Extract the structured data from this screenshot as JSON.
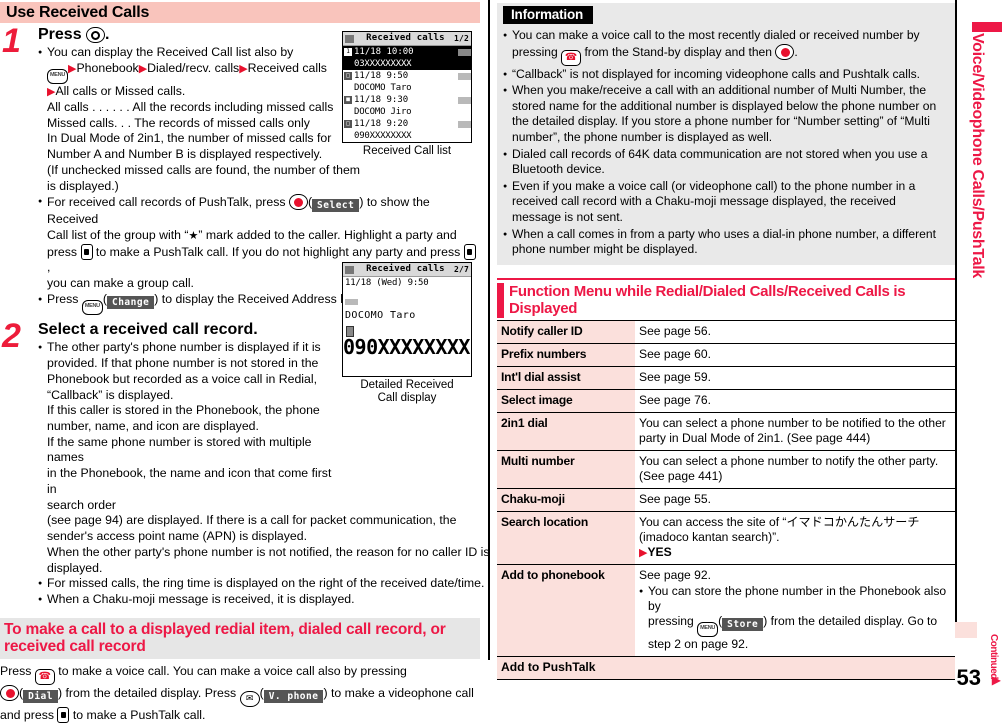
{
  "sidebar": {
    "chapter_title": "Voice/Videophone Calls/PushTalk",
    "continued_label": "Continued",
    "page_number": "53",
    "accent_color": "#ed1846"
  },
  "left": {
    "title": "Use Received Calls",
    "step1": {
      "number": "1",
      "title_pre": "Press",
      "title_post": ".",
      "bullets": [
        {
          "lines": [
            "You can display the Received Call list also by",
            "KEY_MENU ▶Phonebook▶Dialed/recv. calls▶Received calls",
            "▶All calls or Missed calls.",
            "All calls . . . . . .  All the records including missed calls",
            "Missed calls. . .  The records of missed calls only",
            "In Dual Mode of 2in1, the number of missed calls for",
            "Number A and Number B is displayed respectively.",
            "(If unchecked missed calls are found, the number of them is displayed.)"
          ]
        },
        {
          "lines": [
            "For received call records of PushTalk, press KEY_O(Select) to show the Received",
            "Call list of the group with “★” mark added to the caller. Highlight a party and",
            "press KEY_PUSH to make a PushTalk call. If you do not highlight any party and press KEY_PUSH,",
            "you can make a group call."
          ]
        },
        {
          "lines": [
            "Press KEY_MENU(Change) to display the Received Address list."
          ]
        }
      ],
      "softkey_select": "Select",
      "softkey_change": "Change"
    },
    "step2": {
      "number": "2",
      "title": "Select a received call record.",
      "lines": [
        "The other party's phone number is displayed if it is",
        "provided. If that phone number is not stored in the",
        "Phonebook but recorded as a voice call in Redial,",
        "“Callback” is displayed.",
        "If this caller is stored in the Phonebook, the phone",
        "number, name, and icon are displayed.",
        "If the same phone number is stored with multiple names",
        "in the Phonebook, the name and icon that come first in",
        "search order",
        "(see page 94) are displayed. If there is a call for packet communication, the",
        "sender's access point name (APN) is displayed.",
        "When the other party's phone number is not notified, the reason for no caller ID is",
        "displayed."
      ],
      "bullet2": "For missed calls, the ring time is displayed on the right of the received date/time.",
      "bullet3": "When a Chaku-moji message is received, it is displayed."
    },
    "section": {
      "heading_line1": "To make a call to a displayed redial item, dialed call record, or",
      "heading_line2": "received call record",
      "body_l1a": "Press",
      "body_l1b": "to make a voice call. You can make a voice call also by pressing",
      "body_l2a": "from the detailed display. Press",
      "body_l2b": "to make a videophone call",
      "body_l3": "and press",
      "body_l3b": "to make a PushTalk call.",
      "softkey_dial": "Dial",
      "softkey_vphone": "V. phone"
    },
    "screenshot1": {
      "caption": "Received Call list",
      "header_title": "Received calls",
      "header_page": "1/2",
      "rows": [
        {
          "icon": "1",
          "date": "11/18 10:00",
          "tag": "icon-tag",
          "number": "03XXXXXXXXX",
          "selected": true
        },
        {
          "icon": "□",
          "date": "11/18  9:50",
          "tag": "icon-tag",
          "number": "DOCOMO Taro",
          "selected": false
        },
        {
          "icon": "■",
          "date": "11/18  9:30",
          "tag": "icon-tag",
          "number": "DOCOMO Jiro",
          "selected": false
        },
        {
          "icon": "□",
          "date": "11/18  9:20",
          "tag": "icon-tag",
          "number": "090XXXXXXXX",
          "selected": false
        }
      ]
    },
    "screenshot2": {
      "caption_line1": "Detailed Received",
      "caption_line2": "Call display",
      "header_title": "Received calls",
      "header_page": "2/7",
      "datetime": "11/18 (Wed)  9:50",
      "name": "DOCOMO Taro",
      "number": "090XXXXXXXX"
    }
  },
  "right": {
    "info": {
      "label": "Information",
      "bullets": [
        "You can make a voice call to the most recently dialed or received number by pressing KEY_CALL from the Stand-by display and then KEY_O_RED.",
        "“Callback” is not displayed for incoming videophone calls and Pushtalk calls.",
        "When you make/receive a call with an additional number of Multi Number, the stored name for the additional number is displayed below the phone number on the detailed display. If you store a phone number for “Number setting” of “Multi number”, the phone number is displayed as well.",
        "Dialed call records of 64K data communication are not stored when you use a Bluetooth device.",
        "Even if you make a voice call (or videophone call) to the phone number in a received call record with a Chaku-moji message displayed, the received message is not sent.",
        "When a call comes in from a party who uses a dial-in phone number, a different phone number might be displayed."
      ]
    },
    "function_menu": {
      "heading": "Function Menu while Redial/Dialed Calls/Received Calls is Displayed",
      "rows": [
        {
          "key": "Notify caller ID",
          "value": "See page 56."
        },
        {
          "key": "Prefix numbers",
          "value": "See page 60."
        },
        {
          "key": "Int'l dial assist",
          "value": "See page 59."
        },
        {
          "key": "Select image",
          "value": "See page 76."
        },
        {
          "key": "2in1 dial",
          "value": "You can select a phone number to be notified to the other party in Dual Mode of 2in1. (See page 444)"
        },
        {
          "key": "Multi number",
          "value": "You can select a phone number to notify the other party. (See page 441)"
        },
        {
          "key": "Chaku-moji",
          "value": "See page 55."
        },
        {
          "key": "Search location",
          "value": "You can access the site of “イマドコかんたんサーチ (imadoco kantan search)”.",
          "extra_arrow": "▶YES"
        },
        {
          "key": "Add to phonebook",
          "value": "See page 92.",
          "sub_a": "You can store the phone number in the Phonebook also by",
          "sub_b_pre": "pressing",
          "sub_b_post": "from the detailed display. Go to",
          "sub_c": "step 2 on page 92.",
          "softkey_store": "Store"
        },
        {
          "key": "Add to PushTalk",
          "value": "",
          "full_width": true
        }
      ]
    }
  }
}
